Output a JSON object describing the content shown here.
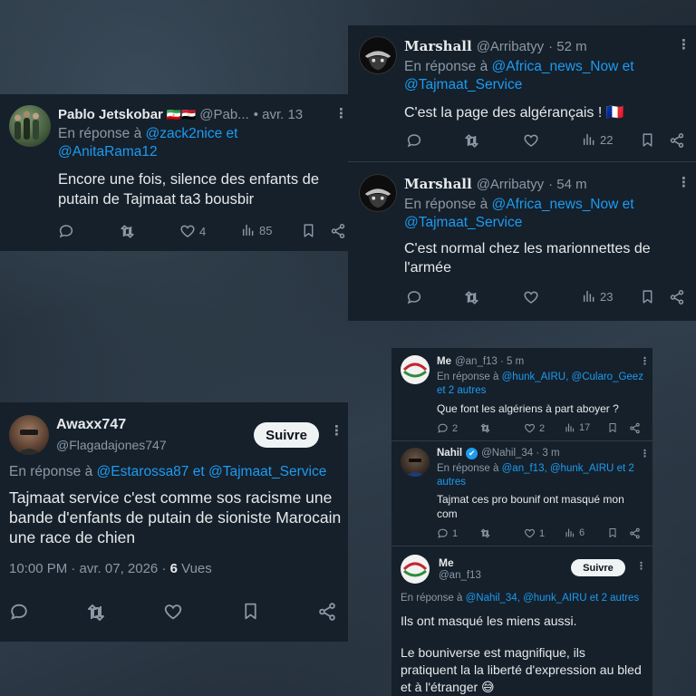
{
  "panel_a": {
    "name": "Pablo Jetskobar",
    "flags": "🇮🇷🇪🇬",
    "handle": "@Pab...",
    "time": "• avr. 13",
    "reply_prefix": "En réponse à",
    "reply_to_1": "@zack2nice",
    "reply_and": "et",
    "reply_to_2": "@AnitaRama12",
    "text": "Encore une fois, silence des enfants de putain de Tajmaat ta3 bousbir",
    "likes": "4",
    "views": "85"
  },
  "panel_b": {
    "tweets": [
      {
        "name": "Marshall",
        "handle": "@Arribatyy",
        "time": "· 52 m",
        "reply_prefix": "En réponse à",
        "reply_to_1": "@Africa_news_Now",
        "reply_and": "et",
        "reply_to_2": "@Tajmaat_Service",
        "text": "C'est la page des algérançais ! 🇫🇷",
        "views": "22"
      },
      {
        "name": "Marshall",
        "handle": "@Arribatyy",
        "time": "· 54 m",
        "reply_prefix": "En réponse à",
        "reply_to_1": "@Africa_news_Now",
        "reply_and": "et",
        "reply_to_2": "@Tajmaat_Service",
        "text": "C'est normal chez les marionnettes de l'armée",
        "views": "23"
      }
    ]
  },
  "panel_c": {
    "name": "Awaxx747",
    "handle": "@Flagadajones747",
    "follow_label": "Suivre",
    "reply_prefix": "En réponse à",
    "reply_to_1": "@Estarossa87",
    "reply_and": "et",
    "reply_to_2": "@Tajmaat_Service",
    "text": "Tajmaat service c'est comme sos racisme une bande d'enfants de putain de sioniste Marocain une race de chien",
    "timestamp": "10:00 PM · avr. 07, 2026 ·",
    "views_count": "6",
    "views_label": "Vues"
  },
  "panel_d": {
    "tweet1": {
      "name": "Me",
      "handle": "@an_f13 · 5 m",
      "reply_prefix": "En réponse à",
      "reply_to_1": "@hunk_AIRU,",
      "reply_to_2": "@Cularo_Geez",
      "reply_rest": "et 2 autres",
      "text": "Que font les algériens à part aboyer ?",
      "replies": "2",
      "likes": "2",
      "views": "17"
    },
    "tweet2": {
      "name": "Nahil",
      "verified": "✔",
      "handle": "@Nahil_34 · 3 m",
      "reply_prefix": "En réponse à",
      "reply_to_1": "@an_f13,",
      "reply_to_2": "@hunk_AIRU",
      "reply_rest": "et 2 autres",
      "text": "Tajmat ces pro bounif ont masqué mon com",
      "replies": "1",
      "likes": "1",
      "views": "6"
    },
    "tweet3": {
      "name": "Me",
      "handle": "@an_f13",
      "follow_label": "Suivre",
      "reply_prefix": "En réponse à",
      "reply_to_1": "@Nahil_34,",
      "reply_to_2": "@hunk_AIRU",
      "reply_rest": "et 2 autres",
      "text_1": "Ils ont masqué les miens aussi.",
      "text_2": "Le bouniverse est magnifique, ils pratiquent la la liberté d'expression au bled et à l'étranger 😅"
    }
  },
  "colors": {
    "panel_bg": "#15202b",
    "link": "#1d9bf0",
    "muted": "#8b98a5",
    "text": "#e7e9ea"
  },
  "icons": [
    "reply-icon",
    "retweet-icon",
    "heart-icon",
    "views-icon",
    "bookmark-icon",
    "share-icon",
    "more-icon"
  ]
}
